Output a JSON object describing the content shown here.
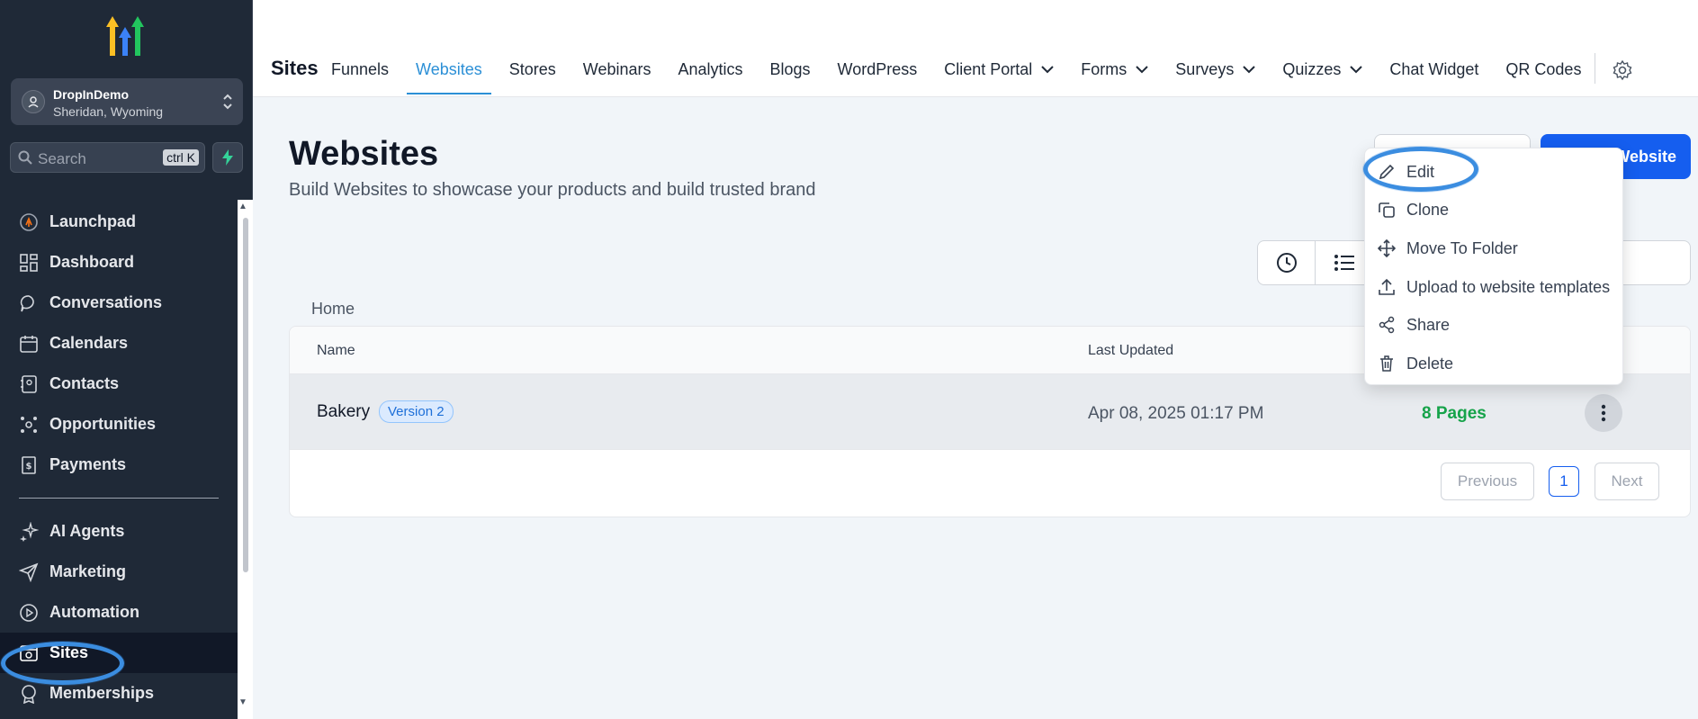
{
  "sidebar": {
    "account": {
      "name": "DropInDemo",
      "location": "Sheridan, Wyoming"
    },
    "search": {
      "placeholder": "Search",
      "shortcut": "ctrl K"
    },
    "items": [
      {
        "label": "Launchpad",
        "icon": "launchpad-icon"
      },
      {
        "label": "Dashboard",
        "icon": "dashboard-icon"
      },
      {
        "label": "Conversations",
        "icon": "chat-icon"
      },
      {
        "label": "Calendars",
        "icon": "calendar-icon"
      },
      {
        "label": "Contacts",
        "icon": "contacts-icon"
      },
      {
        "label": "Opportunities",
        "icon": "opportunities-icon"
      },
      {
        "label": "Payments",
        "icon": "payments-icon"
      }
    ],
    "items2": [
      {
        "label": "AI Agents",
        "icon": "sparkle-icon"
      },
      {
        "label": "Marketing",
        "icon": "send-icon"
      },
      {
        "label": "Automation",
        "icon": "automation-icon"
      },
      {
        "label": "Sites",
        "icon": "sites-icon",
        "active": true
      },
      {
        "label": "Memberships",
        "icon": "badge-icon"
      }
    ]
  },
  "topbar": {
    "brand": "Sites",
    "tabs": [
      {
        "label": "Funnels"
      },
      {
        "label": "Websites",
        "active": true
      },
      {
        "label": "Stores"
      },
      {
        "label": "Webinars"
      },
      {
        "label": "Analytics"
      },
      {
        "label": "Blogs"
      },
      {
        "label": "WordPress"
      },
      {
        "label": "Client Portal",
        "dropdown": true
      },
      {
        "label": "Forms",
        "dropdown": true
      },
      {
        "label": "Surveys",
        "dropdown": true
      },
      {
        "label": "Quizzes",
        "dropdown": true
      },
      {
        "label": "Chat Widget"
      },
      {
        "label": "QR Codes"
      }
    ]
  },
  "main": {
    "title": "Websites",
    "subtitle": "Build Websites to showcase your products and build trusted brand",
    "primary_button": "Website",
    "breadcrumb": "Home",
    "table": {
      "columns": [
        "Name",
        "Last Updated"
      ],
      "rows": [
        {
          "name": "Bakery",
          "badge": "Version 2",
          "updated": "Apr 08, 2025 01:17 PM",
          "pages": "8 Pages"
        }
      ]
    },
    "pagination": {
      "previous": "Previous",
      "page": "1",
      "next": "Next"
    }
  },
  "menu": {
    "items": [
      {
        "label": "Edit",
        "icon": "pencil-icon"
      },
      {
        "label": "Clone",
        "icon": "copy-icon"
      },
      {
        "label": "Move To Folder",
        "icon": "move-icon"
      },
      {
        "label": "Upload to website templates",
        "icon": "upload-icon"
      },
      {
        "label": "Share",
        "icon": "share-icon"
      },
      {
        "label": "Delete",
        "icon": "trash-icon"
      }
    ]
  },
  "colors": {
    "sidebar_bg": "#1f2937",
    "accent": "#2b8fd6",
    "primary": "#155eef",
    "success": "#16a34a",
    "annotation": "#3b8de0"
  }
}
